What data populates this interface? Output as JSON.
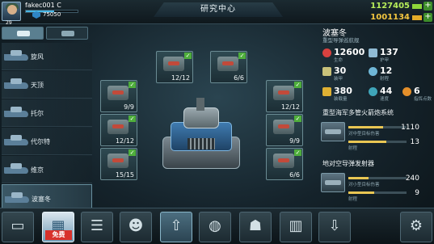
{
  "header": {
    "player_name": "fakec001 C",
    "level": "29",
    "power": "75050",
    "xp_fraction": 0.55,
    "screen_title": "研究中心",
    "resource_green": "1127405",
    "resource_gold": "1001134",
    "plus_label": "+"
  },
  "ships": [
    {
      "name": "旋风"
    },
    {
      "name": "天顶"
    },
    {
      "name": "托尔"
    },
    {
      "name": "代尔特"
    },
    {
      "name": "维京"
    },
    {
      "name": "波塞冬"
    }
  ],
  "modules": [
    {
      "count": "12/12"
    },
    {
      "count": "6/6"
    },
    {
      "count": "9/9"
    },
    {
      "count": "12/12"
    },
    {
      "count": "15/15"
    },
    {
      "count": "12/12"
    },
    {
      "count": "9/9"
    },
    {
      "count": "6/6"
    }
  ],
  "details": {
    "ship_name": "波塞冬",
    "ship_subtitle": "重型导弹巡航舰",
    "stats": [
      {
        "icon": "heart-icon",
        "value": "12600",
        "label": "生命"
      },
      {
        "icon": "shield-icon",
        "value": "137",
        "label": "护甲"
      },
      {
        "icon": "armor-icon",
        "value": "30",
        "label": "装甲"
      },
      {
        "icon": "target-icon",
        "value": "12",
        "label": "射程"
      },
      {
        "icon": "cargo-icon",
        "value": "380",
        "label": "装载量"
      },
      {
        "icon": "speed-icon",
        "value": "44",
        "label": "速度"
      },
      {
        "icon": "star-icon",
        "value": "6",
        "label": "指挥点数"
      }
    ],
    "weapons": [
      {
        "title": "重型海军多管火箭炮系统",
        "damage_label": "对中型目标伤害",
        "damage_value": "1110",
        "damage_fraction": 0.6,
        "range_label": "射程",
        "range_value": "13",
        "range_fraction": 0.65
      },
      {
        "title": "地对空导弹发射器",
        "damage_label": "对小型目标伤害",
        "damage_value": "240",
        "damage_fraction": 0.35,
        "range_label": "射程",
        "range_value": "9",
        "range_fraction": 0.45
      }
    ]
  },
  "bottom_nav": {
    "gift_label": "免费"
  }
}
